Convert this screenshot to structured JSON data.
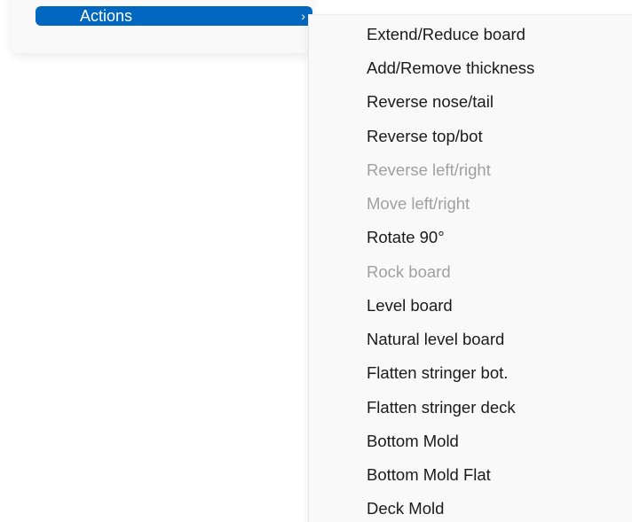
{
  "parent_menu": {
    "active_item": {
      "label": "Actions",
      "chevron": "›"
    }
  },
  "submenu": {
    "items": [
      {
        "label": "Extend/Reduce board",
        "enabled": true
      },
      {
        "label": "Add/Remove thickness",
        "enabled": true
      },
      {
        "label": "Reverse nose/tail",
        "enabled": true
      },
      {
        "label": "Reverse top/bot",
        "enabled": true
      },
      {
        "label": "Reverse left/right",
        "enabled": false
      },
      {
        "label": "Move left/right",
        "enabled": false
      },
      {
        "label": "Rotate 90°",
        "enabled": true
      },
      {
        "label": "Rock board",
        "enabled": false
      },
      {
        "label": "Level board",
        "enabled": true
      },
      {
        "label": "Natural level board",
        "enabled": true
      },
      {
        "label": "Flatten stringer bot.",
        "enabled": true
      },
      {
        "label": "Flatten stringer deck",
        "enabled": true
      },
      {
        "label": "Bottom Mold",
        "enabled": true
      },
      {
        "label": "Bottom Mold Flat",
        "enabled": true
      },
      {
        "label": "Deck Mold",
        "enabled": true
      }
    ]
  },
  "colors": {
    "highlight": "#0067c0",
    "text": "#1a1a1a",
    "disabled_text": "#a0a0a0",
    "menu_background": "#f9f9f9"
  }
}
